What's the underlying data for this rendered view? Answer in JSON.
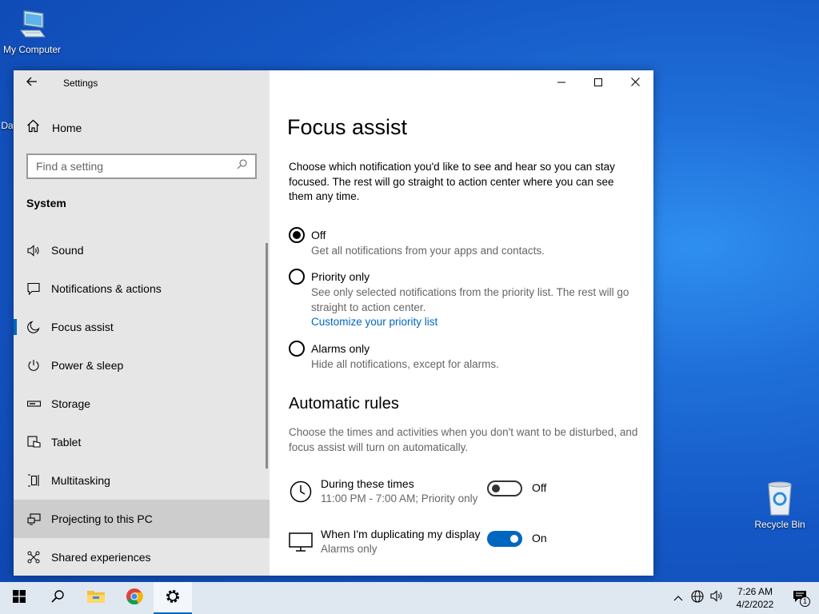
{
  "desktop": {
    "icons": [
      {
        "label": "My Computer",
        "icon": "computer-icon"
      },
      {
        "label": "Recycle Bin",
        "icon": "recycle-bin-icon"
      },
      {
        "label": "Da",
        "icon": "partial-desktop-icon"
      }
    ]
  },
  "window": {
    "app_title": "Settings",
    "sidebar": {
      "home_label": "Home",
      "search_placeholder": "Find a setting",
      "section_title": "System",
      "items": [
        {
          "label": "Sound",
          "icon": "speaker-icon"
        },
        {
          "label": "Notifications & actions",
          "icon": "notification-icon"
        },
        {
          "label": "Focus assist",
          "icon": "moon-icon",
          "selected": true
        },
        {
          "label": "Power & sleep",
          "icon": "power-icon"
        },
        {
          "label": "Storage",
          "icon": "storage-icon"
        },
        {
          "label": "Tablet",
          "icon": "tablet-icon"
        },
        {
          "label": "Multitasking",
          "icon": "multitasking-icon"
        },
        {
          "label": "Projecting to this PC",
          "icon": "projecting-icon",
          "hovered": true
        },
        {
          "label": "Shared experiences",
          "icon": "shared-experiences-icon"
        }
      ]
    },
    "content": {
      "title": "Focus assist",
      "description": "Choose which notification you'd like to see and hear so you can stay focused. The rest will go straight to action center where you can see them any time.",
      "options": [
        {
          "label": "Off",
          "sub": "Get all notifications from your apps and contacts.",
          "checked": true
        },
        {
          "label": "Priority only",
          "sub": "See only selected notifications from the priority list. The rest will go straight to action center.",
          "link": "Customize your priority list",
          "checked": false
        },
        {
          "label": "Alarms only",
          "sub": "Hide all notifications, except for alarms.",
          "checked": false
        }
      ],
      "rules_title": "Automatic rules",
      "rules_description": "Choose the times and activities when you don't want to be disturbed, and focus assist will turn on automatically.",
      "rules": [
        {
          "name": "During these times",
          "sub": "11:00 PM - 7:00 AM; Priority only",
          "state": "Off",
          "on": false,
          "icon": "clock-icon"
        },
        {
          "name": "When I'm duplicating my display",
          "sub": "Alarms only",
          "state": "On",
          "on": true,
          "icon": "monitor-icon"
        }
      ]
    }
  },
  "taskbar": {
    "time": "7:26 AM",
    "date": "4/2/2022",
    "notification_count": "1"
  },
  "colors": {
    "accent": "#0067c0",
    "sidebar_bg": "#e6e6e6",
    "taskbar_bg": "#dfe7f1"
  }
}
